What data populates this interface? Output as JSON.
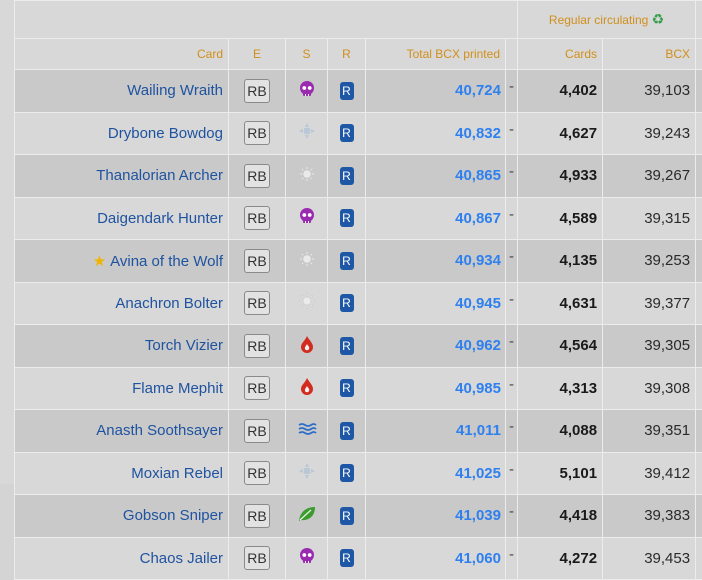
{
  "section_header": {
    "label": "Regular circulating",
    "icon": "recycle-icon"
  },
  "columns": {
    "card": "Card",
    "e": "E",
    "s": "S",
    "r": "R",
    "total": "Total BCX printed",
    "cards": "Cards",
    "bcx": "BCX"
  },
  "colors": {
    "header_text": "#d08f1c",
    "link": "#1f53a0",
    "total": "#2f80ef",
    "rarity_badge": "#1e57a6"
  },
  "rows": [
    {
      "name": "Wailing Wraith",
      "e": "RB",
      "s_icon": "death-skull-icon",
      "r": "R",
      "total": "40,724",
      "dash": "-",
      "cards": "4,402",
      "bcx": "39,103",
      "starred": false
    },
    {
      "name": "Drybone Bowdog",
      "e": "RB",
      "s_icon": "neutral-icon",
      "r": "R",
      "total": "40,832",
      "dash": "-",
      "cards": "4,627",
      "bcx": "39,243",
      "starred": false
    },
    {
      "name": "Thanalorian Archer",
      "e": "RB",
      "s_icon": "life-sun-icon",
      "r": "R",
      "total": "40,865",
      "dash": "-",
      "cards": "4,933",
      "bcx": "39,267",
      "starred": false
    },
    {
      "name": "Daigendark Hunter",
      "e": "RB",
      "s_icon": "death-skull-icon",
      "r": "R",
      "total": "40,867",
      "dash": "-",
      "cards": "4,589",
      "bcx": "39,315",
      "starred": false
    },
    {
      "name": "Avina of the Wolf",
      "e": "RB",
      "s_icon": "life-sun-icon",
      "r": "R",
      "total": "40,934",
      "dash": "-",
      "cards": "4,135",
      "bcx": "39,253",
      "starred": true
    },
    {
      "name": "Anachron Bolter",
      "e": "RB",
      "s_icon": "life-sun-icon",
      "r": "R",
      "total": "40,945",
      "dash": "-",
      "cards": "4,631",
      "bcx": "39,377",
      "starred": false
    },
    {
      "name": "Torch Vizier",
      "e": "RB",
      "s_icon": "fire-drop-icon",
      "r": "R",
      "total": "40,962",
      "dash": "-",
      "cards": "4,564",
      "bcx": "39,305",
      "starred": false
    },
    {
      "name": "Flame Mephit",
      "e": "RB",
      "s_icon": "fire-drop-icon",
      "r": "R",
      "total": "40,985",
      "dash": "-",
      "cards": "4,313",
      "bcx": "39,308",
      "starred": false
    },
    {
      "name": "Anasth Soothsayer",
      "e": "RB",
      "s_icon": "water-waves-icon",
      "r": "R",
      "total": "41,011",
      "dash": "-",
      "cards": "4,088",
      "bcx": "39,351",
      "starred": false
    },
    {
      "name": "Moxian Rebel",
      "e": "RB",
      "s_icon": "neutral-icon",
      "r": "R",
      "total": "41,025",
      "dash": "-",
      "cards": "5,101",
      "bcx": "39,412",
      "starred": false
    },
    {
      "name": "Gobson Sniper",
      "e": "RB",
      "s_icon": "earth-leaf-icon",
      "r": "R",
      "total": "41,039",
      "dash": "-",
      "cards": "4,418",
      "bcx": "39,383",
      "starred": false
    },
    {
      "name": "Chaos Jailer",
      "e": "RB",
      "s_icon": "death-skull-icon",
      "r": "R",
      "total": "41,060",
      "dash": "-",
      "cards": "4,272",
      "bcx": "39,453",
      "starred": false
    }
  ]
}
